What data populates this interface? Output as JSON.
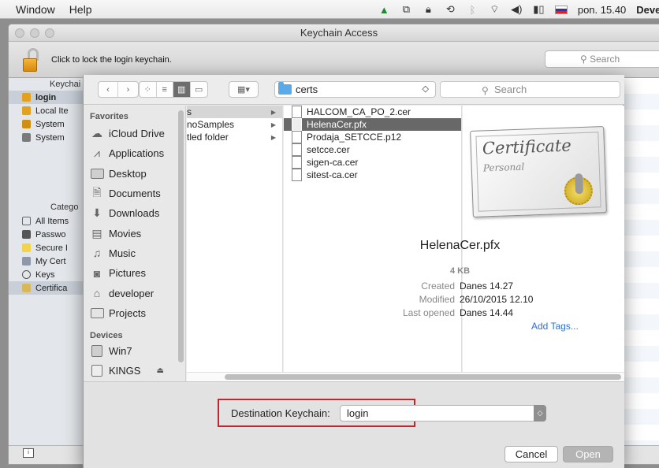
{
  "menubar": {
    "items": [
      "Window",
      "Help"
    ],
    "clock": "pon. 15.40",
    "user": "Devel"
  },
  "keychain_window": {
    "title": "Keychain Access",
    "lock_message": "Click to lock the login keychain.",
    "search_placeholder": "Search",
    "sidebar": {
      "keychains_header": "Keychai",
      "keychains": [
        "login",
        "Local Ite",
        "System",
        "System"
      ],
      "category_header": "Catego",
      "categories": [
        "All Items",
        "Passwo",
        "Secure I",
        "My Cert",
        "Keys",
        "Certifica"
      ]
    }
  },
  "sheet": {
    "toolbar": {
      "back": "‹",
      "forward": "›",
      "path": "certs",
      "search_placeholder": "Search"
    },
    "sidebar": {
      "favorites_header": "Favorites",
      "favorites": [
        {
          "label": "iCloud Drive",
          "icon": "cloud-icon"
        },
        {
          "label": "Applications",
          "icon": "applications-icon"
        },
        {
          "label": "Desktop",
          "icon": "desktop-icon"
        },
        {
          "label": "Documents",
          "icon": "documents-icon"
        },
        {
          "label": "Downloads",
          "icon": "downloads-icon"
        },
        {
          "label": "Movies",
          "icon": "movies-icon"
        },
        {
          "label": "Music",
          "icon": "music-icon"
        },
        {
          "label": "Pictures",
          "icon": "pictures-icon"
        },
        {
          "label": "developer",
          "icon": "home-icon"
        },
        {
          "label": "Projects",
          "icon": "folder-icon"
        }
      ],
      "devices_header": "Devices",
      "devices": [
        {
          "label": "Win7",
          "icon": "disk-icon"
        },
        {
          "label": "KINGS",
          "icon": "usb-drive-icon"
        }
      ]
    },
    "column1": [
      "s",
      "noSamples",
      "tled folder"
    ],
    "column2": [
      "HALCOM_CA_PO_2.cer",
      "HelenaCer.pfx",
      "Prodaja_SETCCE.p12",
      "setcce.cer",
      "sigen-ca.cer",
      "sitest-ca.cer"
    ],
    "selected_file": "HelenaCer.pfx",
    "preview": {
      "name": "HelenaCer.pfx",
      "size": "4 KB",
      "created_label": "Created",
      "created": "Danes 14.27",
      "modified_label": "Modified",
      "modified": "26/10/2015 12.10",
      "last_opened_label": "Last opened",
      "last_opened": "Danes 14.44",
      "add_tags": "Add Tags...",
      "cert_title": "Certificate",
      "cert_subtitle": "Personal"
    },
    "destination": {
      "label": "Destination Keychain:",
      "value": "login"
    },
    "buttons": {
      "cancel": "Cancel",
      "open": "Open"
    }
  },
  "colors": {
    "selection_gray": "#686868",
    "highlight_red": "#c0262d",
    "link_blue": "#2a72d8",
    "folder_blue": "#5aa9e8"
  }
}
